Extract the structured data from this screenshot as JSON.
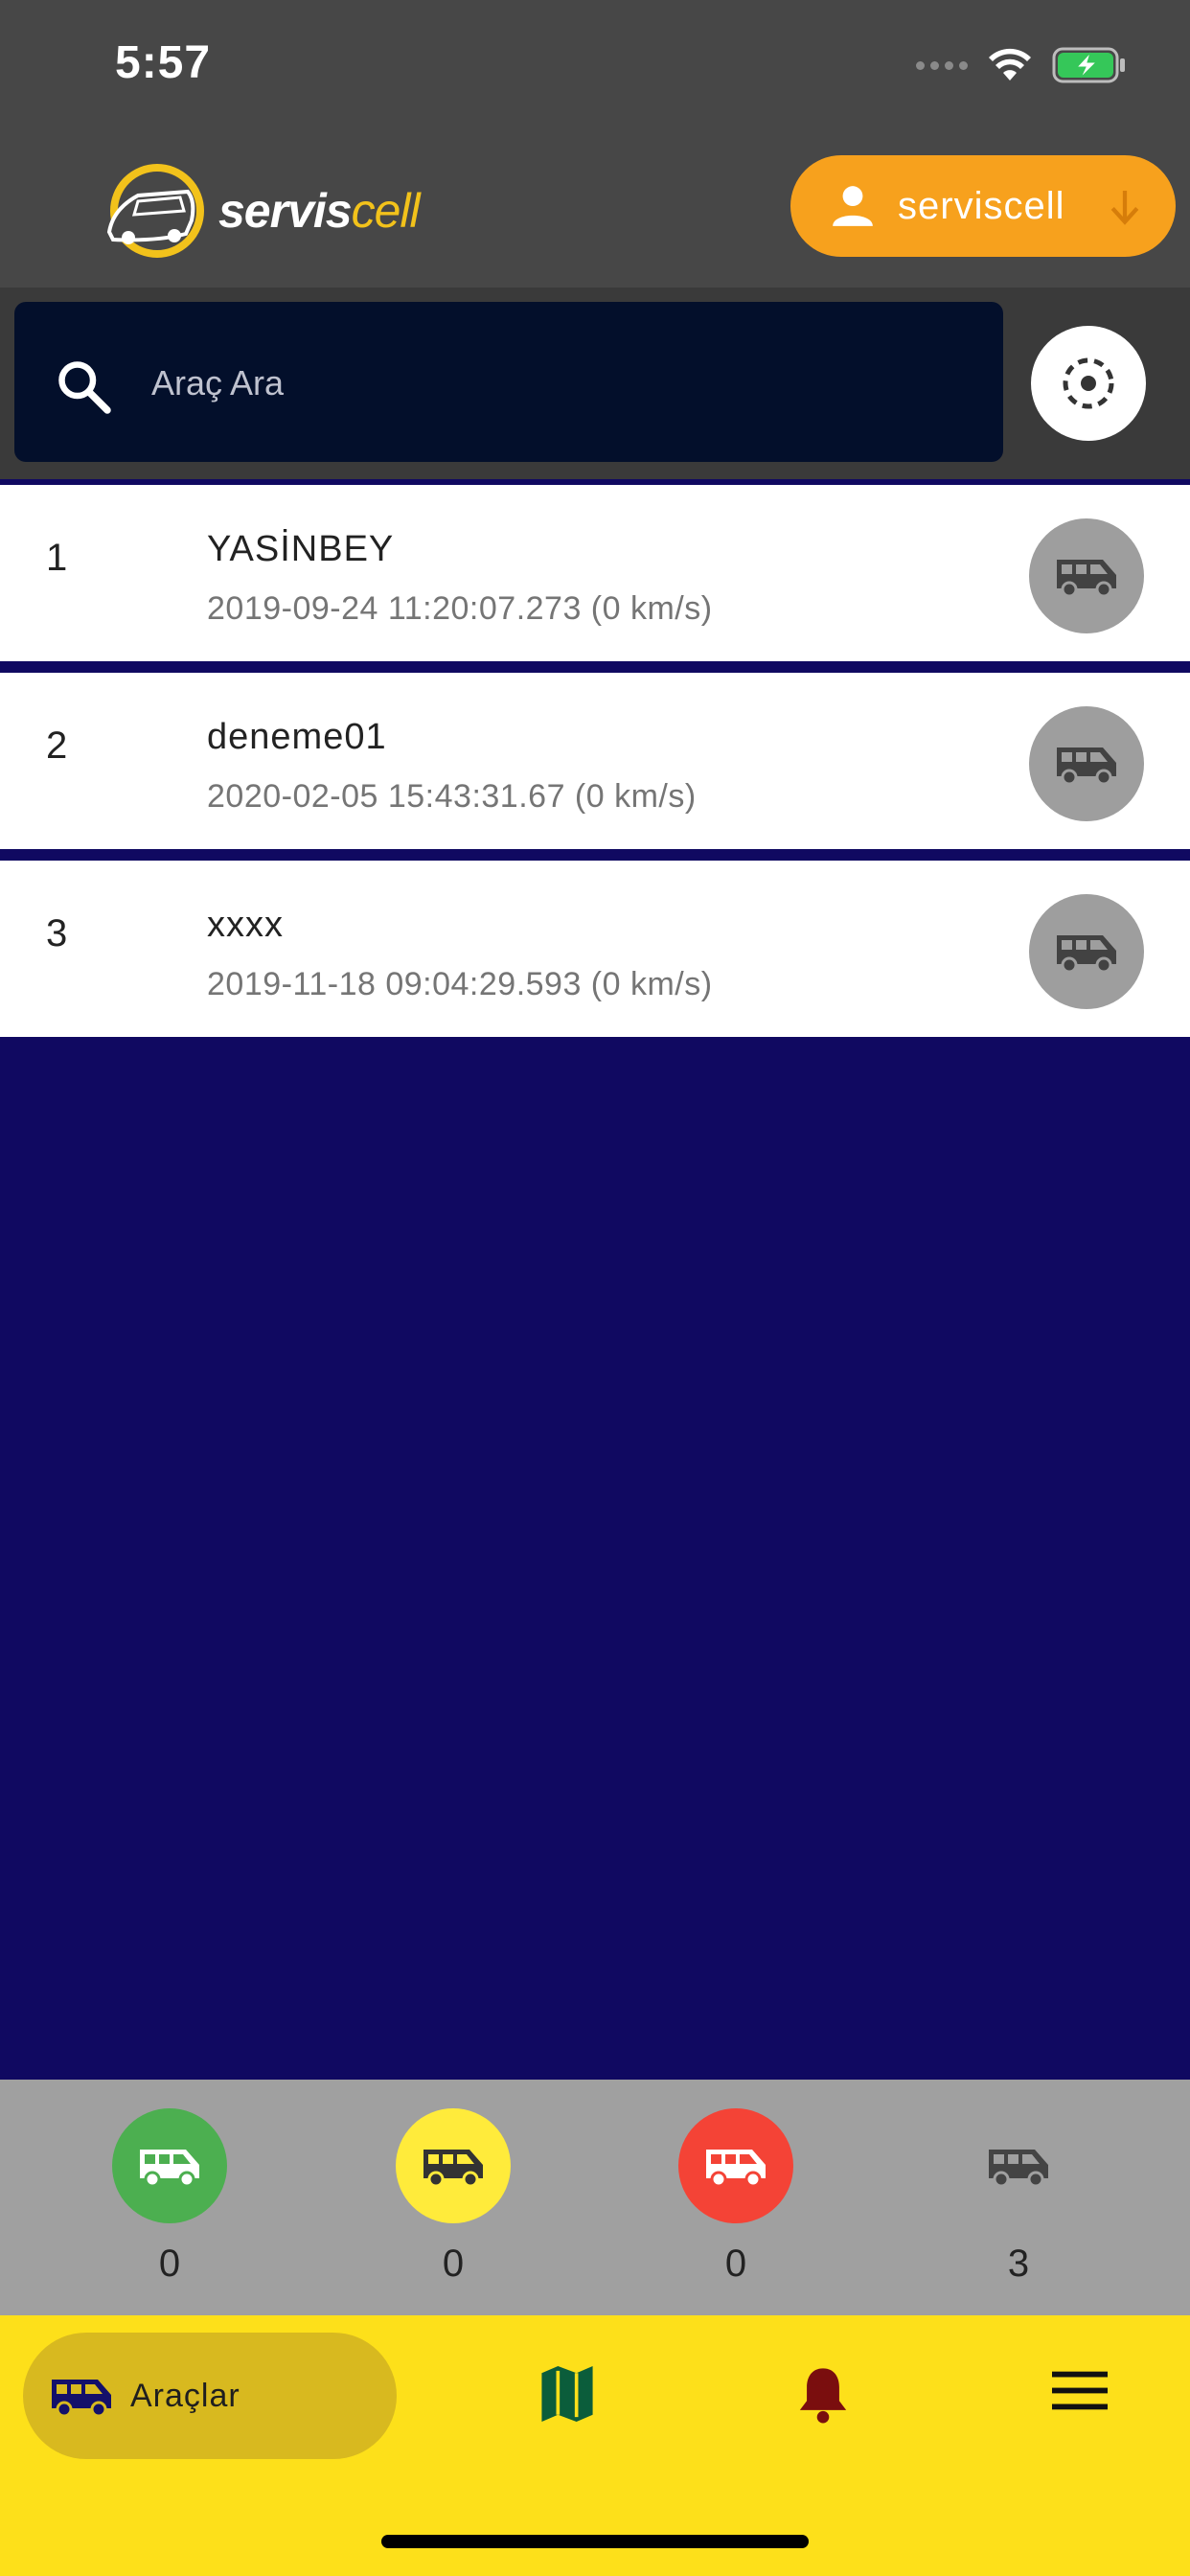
{
  "status_bar": {
    "time": "5:57",
    "icons": [
      "signal-icon",
      "wifi-icon",
      "battery-charging-icon"
    ]
  },
  "header": {
    "logo": {
      "servis": "servis",
      "cell": "cell",
      "icon": "bus-logo-icon"
    },
    "user_button": {
      "label": "serviscell",
      "icon": "person-icon",
      "arrow": "arrow-down-icon",
      "color": "#f7a11d"
    }
  },
  "search": {
    "placeholder": "Araç Ara",
    "value": "",
    "icon": "search-icon",
    "locate_icon": "gps-locate-icon"
  },
  "vehicles": [
    {
      "index": "1",
      "name": "YASİNBEY",
      "meta": "2019-09-24 11:20:07.273 (0 km/s)",
      "icon": "van-icon"
    },
    {
      "index": "2",
      "name": "deneme01",
      "meta": "2020-02-05 15:43:31.67 (0 km/s)",
      "icon": "van-icon"
    },
    {
      "index": "3",
      "name": "xxxx",
      "meta": "2019-11-18 09:04:29.593 (0 km/s)",
      "icon": "van-icon"
    }
  ],
  "summary": [
    {
      "count": "0",
      "color": "#4caf50",
      "icon_color": "#ffffff"
    },
    {
      "count": "0",
      "color": "#ffeb3b",
      "icon_color": "#333333"
    },
    {
      "count": "0",
      "color": "#f44336",
      "icon_color": "#ffffff"
    },
    {
      "count": "3",
      "color": "transparent",
      "icon_color": "#444444"
    }
  ],
  "bottom_nav": {
    "active": {
      "label": "Araçlar",
      "icon": "van-icon"
    },
    "items": [
      {
        "icon": "map-icon",
        "color": "#0b5d3b"
      },
      {
        "icon": "bell-icon",
        "color": "#7a0e0e"
      },
      {
        "icon": "menu-icon",
        "color": "#111111"
      }
    ]
  },
  "colors": {
    "background": "#100961",
    "header": "#474747",
    "nav": "#fde01a"
  }
}
